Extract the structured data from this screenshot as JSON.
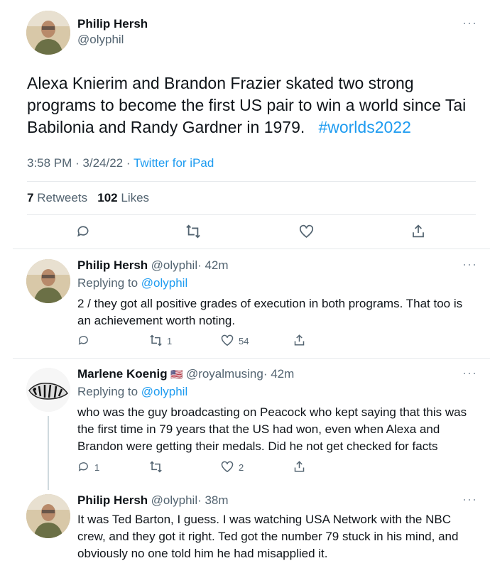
{
  "main_tweet": {
    "name": "Philip Hersh",
    "handle": "@olyphil",
    "text_1": "Alexa Knierim and Brandon Frazier skated two strong programs to become the first US pair to win a world since Tai Babilonia and Randy Gardner in 1979.",
    "hashtag": "#worlds2022",
    "time": "3:58 PM · 3/24/22 · ",
    "source": "Twitter for iPad",
    "retweets_count": "7",
    "retweets_label": "Retweets",
    "likes_count": "102",
    "likes_label": "Likes"
  },
  "replies": [
    {
      "name": "Philip Hersh",
      "handle": "@olyphil",
      "time": "· 42m",
      "replying_prefix": "Replying to ",
      "replying_to": "@olyphil",
      "text": "2 / they got all positive grades of execution in both programs.  That too is an achievement worth noting.",
      "replies": "",
      "retweets": "1",
      "likes": "54"
    },
    {
      "name": "Marlene Koenig",
      "flag": "🇺🇸",
      "handle": "@royalmusing",
      "time": "· 42m",
      "replying_prefix": "Replying to ",
      "replying_to": "@olyphil",
      "text": "who was the guy broadcasting on Peacock who kept saying that this was the first time in 79 years that the US had won, even when Alexa and Brandon were getting their medals.  Did he not get checked for facts",
      "replies": "1",
      "retweets": "",
      "likes": "2"
    },
    {
      "name": "Philip Hersh",
      "handle": "@olyphil",
      "time": "· 38m",
      "text": "It was Ted Barton, I guess.  I was watching USA Network with the NBC crew, and they got it right.  Ted got the number 79 stuck in his mind, and obviously no one told him he had misapplied it."
    }
  ],
  "more_label": "···",
  "colors": {
    "link": "#1d9bf0",
    "secondary": "#536471",
    "divider": "#e6e9ec"
  }
}
